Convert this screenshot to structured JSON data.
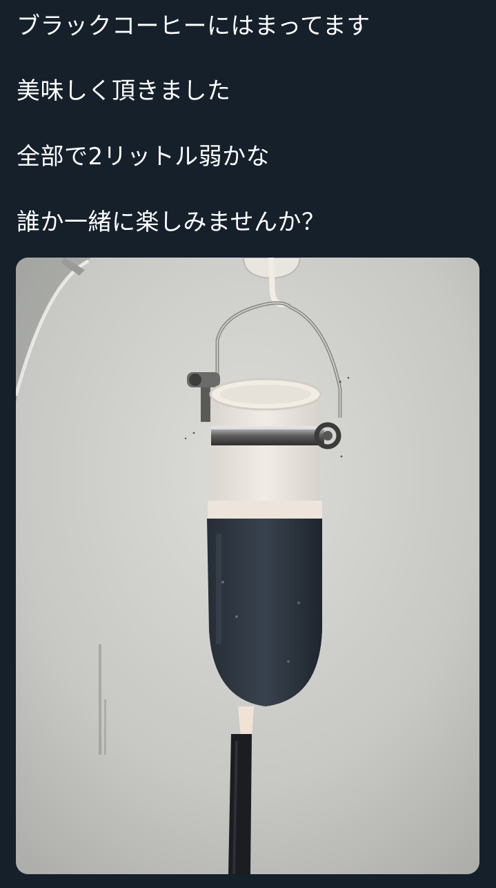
{
  "tweet": {
    "text_lines": [
      "ブラックコーヒーにはまってます",
      "美味しく頂きました",
      "全部で2リットル弱かな",
      "誰か一緒に楽しみませんか？"
    ]
  },
  "media": {
    "type": "photo"
  },
  "colors": {
    "background": "#15202b",
    "text": "#ffffff"
  }
}
